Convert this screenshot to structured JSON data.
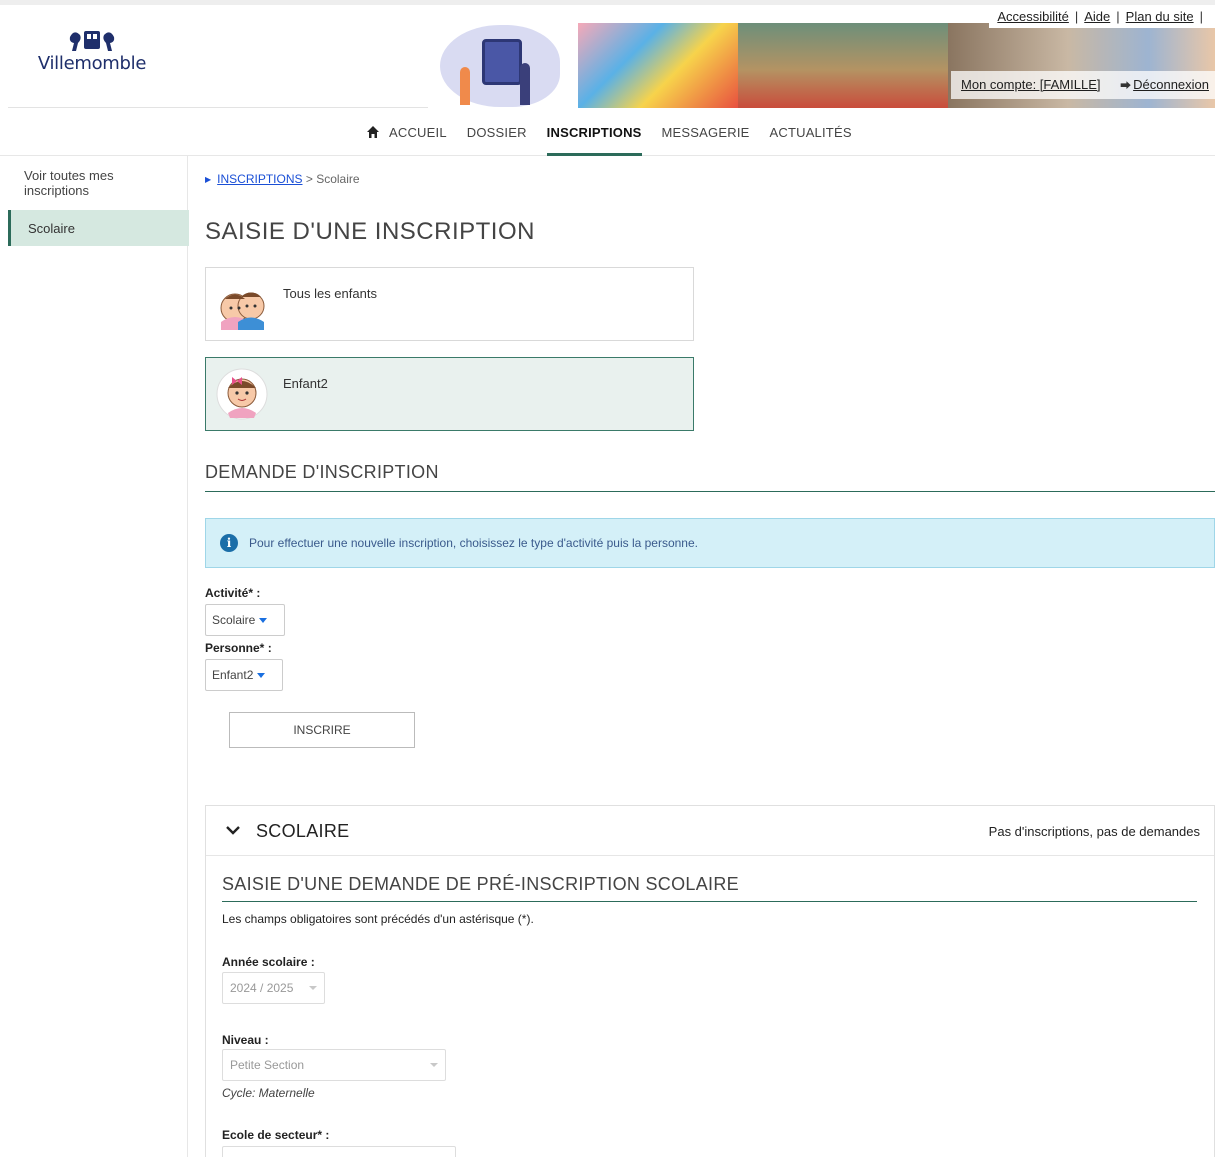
{
  "header": {
    "logo_text": "Villemomble",
    "top_links": [
      "Accessibilité",
      "Aide",
      "Plan du site"
    ],
    "separator": "|",
    "account_label": "Mon compte: [FAMILLE]",
    "logout_label": "Déconnexion"
  },
  "nav": {
    "items": [
      {
        "label": "ACCUEIL",
        "icon": "home-icon",
        "active": false
      },
      {
        "label": "DOSSIER",
        "active": false
      },
      {
        "label": "INSCRIPTIONS",
        "active": true
      },
      {
        "label": "MESSAGERIE",
        "active": false
      },
      {
        "label": "ACTUALITÉS",
        "active": false
      }
    ]
  },
  "sidebar": {
    "link_all": "Voir toutes mes inscriptions",
    "active_item": "Scolaire"
  },
  "breadcrumb": {
    "parent": "INSCRIPTIONS",
    "separator": ">",
    "current": "Scolaire"
  },
  "page_title": "SAISIE D'UNE INSCRIPTION",
  "persons": [
    {
      "name": "Tous les enfants",
      "selected": false
    },
    {
      "name": "Enfant2",
      "selected": true
    }
  ],
  "request_section": {
    "title": "DEMANDE D'INSCRIPTION",
    "info_text": "Pour effectuer une nouvelle inscription, choisissez le type d'activité puis la personne.",
    "activity_label": "Activité* :",
    "activity_value": "Scolaire",
    "person_label": "Personne* :",
    "person_value": "Enfant2",
    "submit_label": "INSCRIRE"
  },
  "scolaire_panel": {
    "title": "SCOLAIRE",
    "status": "Pas d'inscriptions, pas de demandes",
    "form_title": "SAISIE D'UNE DEMANDE DE PRÉ-INSCRIPTION SCOLAIRE",
    "mandatory_note": "Les champs obligatoires sont précédés d'un astérisque (*).",
    "year_label": "Année scolaire :",
    "year_value": "2024 / 2025",
    "level_label": "Niveau :",
    "level_value": "Petite Section",
    "cycle_text": "Cycle: Maternelle",
    "school_label": "Ecole de secteur* :"
  },
  "colors": {
    "accent": "#2c6b5a",
    "link": "#1a4fd6",
    "selected_bg": "#e9f1ee",
    "alert_bg": "#d4f0f8"
  }
}
